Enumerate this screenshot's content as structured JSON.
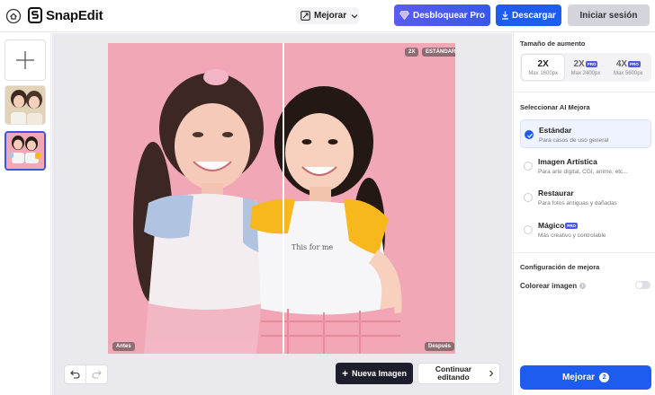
{
  "header": {
    "logo_text": "SnapEdit",
    "mode_select": {
      "value": "Mejorar"
    },
    "unlock_pro_label": "Desbloquear Pro",
    "download_label": "Descargar",
    "login_label": "Iniciar sesión"
  },
  "canvas": {
    "badge_scale": "2X",
    "badge_model": "ESTÁNDAR",
    "before_label": "Antes",
    "after_label": "Después",
    "new_image_label": "Nueva Imagen",
    "continue_label_line1": "Continuar",
    "continue_label_line2": "editando"
  },
  "panel": {
    "scale_title": "Tamaño de aumento",
    "scale_options": [
      {
        "label": "2X",
        "sub": "Max 1600px",
        "pro": ""
      },
      {
        "label": "2X",
        "sub": "Max 2400px",
        "pro": "PRO"
      },
      {
        "label": "4X",
        "sub": "Max 5600px",
        "pro": "PRO"
      }
    ],
    "model_title": "Seleccionar AI Mejora",
    "models": [
      {
        "name": "Estándar",
        "desc": "Para casos de uso general",
        "pro": ""
      },
      {
        "name": "Imagen Artística",
        "desc": "Para arte digital, CGI, anime, etc...",
        "pro": ""
      },
      {
        "name": "Restaurar",
        "desc": "Para fotos antiguas y dañadas",
        "pro": ""
      },
      {
        "name": "Mágico",
        "desc": "Más creativo y controlable",
        "pro": "PRO"
      }
    ],
    "config_title": "Configuración de mejora",
    "colorize_label": "Colorear imagen",
    "info_glyph": "i",
    "enhance_label": "Mejorar",
    "enhance_credits": "2"
  },
  "colors": {
    "accent": "#1e5cf0",
    "photo_bg": "#f1a7b5"
  }
}
